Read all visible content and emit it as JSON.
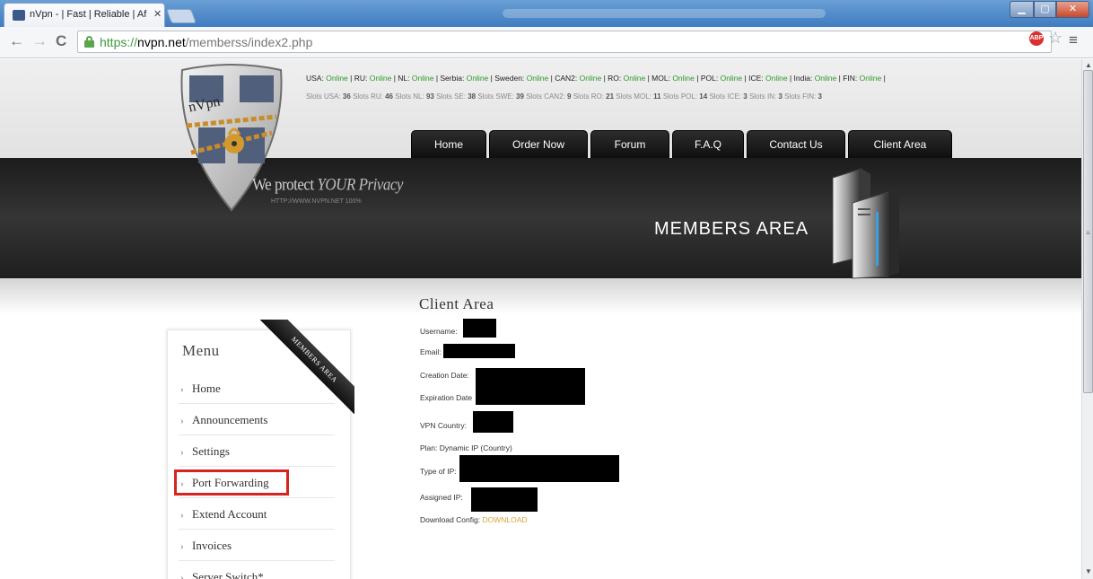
{
  "browser": {
    "tab_title": "nVpn - | Fast | Reliable | Af",
    "url_scheme": "https://",
    "url_host": "nvpn.net",
    "url_path": "/memberss/index2.php",
    "extension_label": "ABP"
  },
  "header": {
    "logo_text": "nVpn",
    "slogan_prefix": "We",
    "slogan_protect": "protect",
    "slogan_yours": "YOUR Privacy",
    "slogan_url": "HTTP://WWW.NVPN.NET 100%",
    "banner_title": "MEMBERS AREA",
    "online_status": [
      {
        "label": "USA:",
        "status": "Online"
      },
      {
        "label": "RU:",
        "status": "Online"
      },
      {
        "label": "NL:",
        "status": "Online"
      },
      {
        "label": "Serbia:",
        "status": "Online"
      },
      {
        "label": "Sweden:",
        "status": "Online"
      },
      {
        "label": "CAN2:",
        "status": "Online"
      },
      {
        "label": "RO:",
        "status": "Online"
      },
      {
        "label": "MOL:",
        "status": "Online"
      },
      {
        "label": "POL:",
        "status": "Online"
      },
      {
        "label": "ICE:",
        "status": "Online"
      },
      {
        "label": "India:",
        "status": "Online"
      },
      {
        "label": "FIN:",
        "status": "Online"
      }
    ],
    "slots": [
      {
        "label": "Slots USA:",
        "count": "36"
      },
      {
        "label": "Slots RU:",
        "count": "46"
      },
      {
        "label": "Slots NL:",
        "count": "93"
      },
      {
        "label": "Slots SE:",
        "count": "38"
      },
      {
        "label": "Slots SWE:",
        "count": "39"
      },
      {
        "label": "Slots CAN2:",
        "count": "9"
      },
      {
        "label": "Slots RO:",
        "count": "21"
      },
      {
        "label": "Slots MOL:",
        "count": "11"
      },
      {
        "label": "Slots POL:",
        "count": "14"
      },
      {
        "label": "Slots ICE:",
        "count": "3"
      },
      {
        "label": "Slots IN:",
        "count": "3"
      },
      {
        "label": "Slots FIN:",
        "count": "3"
      }
    ],
    "nav": [
      "Home",
      "Order Now",
      "Forum",
      "F.A.Q",
      "Contact Us",
      "Client Area"
    ]
  },
  "sidebar": {
    "title": "Menu",
    "ribbon": "MEMBERS AREA",
    "items": [
      "Home",
      "Announcements",
      "Settings",
      "Port Forwarding",
      "Extend Account",
      "Invoices",
      "Server Switch*"
    ]
  },
  "client_area": {
    "title": "Client Area",
    "username_label": "Username:",
    "email_label": "Email:",
    "creation_label": "Creation Date:",
    "expiration_label": "Expiration Date",
    "country_label": "VPN Country:",
    "plan_text": "Plan: Dynamic IP (Country)",
    "ip_type_label": "Type of IP:",
    "assigned_label": "Assigned IP:",
    "download_label": "Download Config:",
    "download_link": "DOWNLOAD"
  },
  "colors": {
    "online": "#2b9a2b",
    "download_link": "#d9a43c",
    "highlight": "#d7241f"
  }
}
